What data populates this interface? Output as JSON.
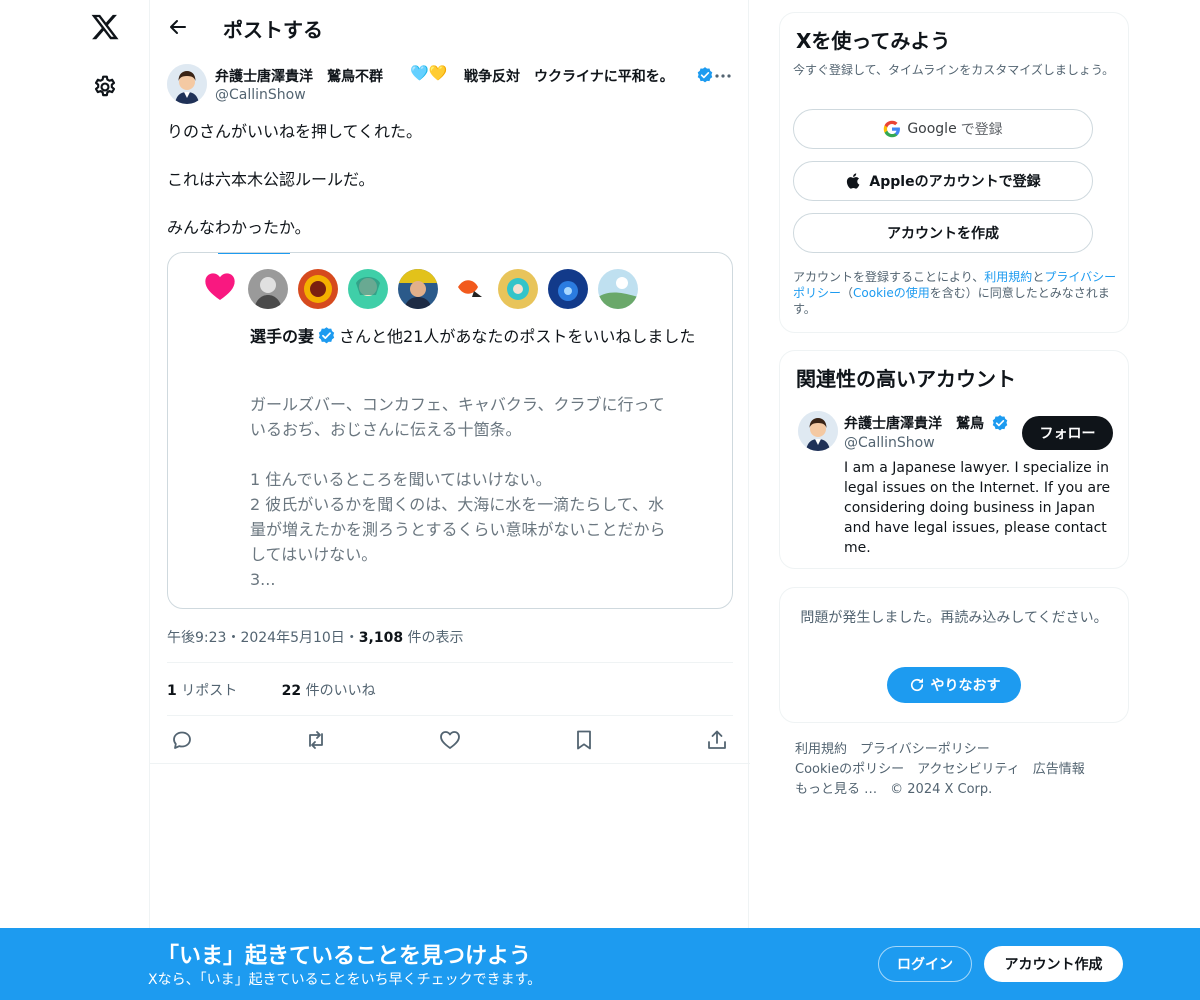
{
  "header": {
    "title": "ポストする"
  },
  "tweet": {
    "author_name": "弁護士唐澤貴洋　鷲鳥不群",
    "author_hearts": "🩵💛",
    "author_name_suffix": "戦争反対　ウクライナに平和を。",
    "author_handle": "@CallinShow",
    "text_lines": [
      "りのさんがいいねを押してくれた。",
      "これは六本木公認ルールだ。",
      "みんなわかったか。"
    ],
    "timestamp": "午後9:23・2024年5月10日・",
    "views_count": "3,108",
    "views_label": " 件の表示",
    "reposts_count": "1",
    "reposts_label": " リポスト",
    "likes_count": "22",
    "likes_label": " 件のいいね"
  },
  "embedded_image": {
    "liker_name": "選手の妻",
    "liker_suffix": "さんと他21人があなたのポストをいいねしました",
    "body_lines": [
      "ガールズバー、コンカフェ、キャバクラ、クラブに行って",
      "いるおぢ、おじさんに伝える十箇条。",
      "",
      "1 住んでいるところを聞いてはいけない。",
      "2 彼氏がいるかを聞くのは、大海に水を一滴たらして、水",
      "量が増えたかを測ろうとするくらい意味がないことだから",
      "してはいけない。",
      "3..."
    ]
  },
  "signup_card": {
    "title": "Xを使ってみよう",
    "description": "今すぐ登録して、タイムラインをカスタマイズしましょう。",
    "google_label": "Google",
    "google_suffix": "で登録",
    "apple_label": "Appleのアカウントで登録",
    "create_label": "アカウントを作成",
    "terms_prefix": "アカウントを登録することにより、",
    "terms_link1": "利用規約",
    "terms_and": "と",
    "terms_link2": "プライバシーポリシー",
    "terms_mid": "（",
    "terms_link3": "Cookieの使用",
    "terms_suffix": "を含む）に同意したとみなされます。"
  },
  "related_card": {
    "title": "関連性の高いアカウント",
    "name": "弁護士唐澤貴洋　鷲鳥",
    "handle": "@CallinShow",
    "follow_label": "フォロー",
    "bio": "I am a Japanese lawyer. I specialize in legal issues on the Internet. If you are considering doing business in Japan and have legal issues, please contact me."
  },
  "error_card": {
    "message": "問題が発生しました。再読み込みしてください。",
    "retry_label": "やりなおす"
  },
  "footer": {
    "links": [
      "利用規約",
      "プライバシーポリシー",
      "Cookieのポリシー",
      "アクセシビリティ",
      "広告情報",
      "もっと見る …",
      "© 2024 X Corp."
    ]
  },
  "banner": {
    "title": "「いま」起きていることを見つけよう",
    "subtitle": "Xなら、「いま」起きていることをいち早くチェックできます。",
    "login_label": "ログイン",
    "signup_label": "アカウント作成"
  },
  "colors": {
    "accent": "#1d9bf0",
    "text": "#0f1419",
    "muted": "#536471",
    "like_heart": "#f91880"
  }
}
